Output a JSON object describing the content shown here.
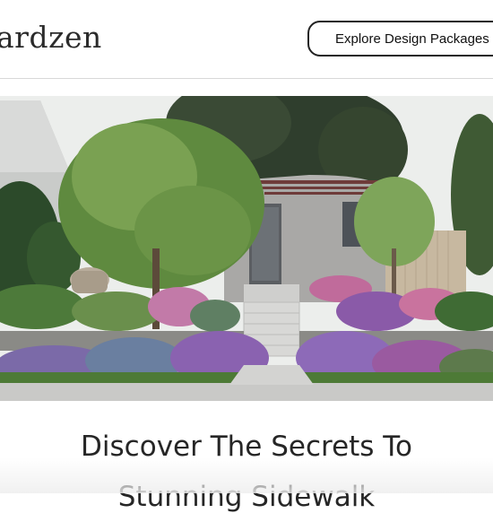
{
  "header": {
    "logo_text": "ardzen",
    "cta_label": "Explore Design Packages"
  },
  "hero": {
    "image_alt": "Front yard garden design with a modern grey house, trees, and flowering plants"
  },
  "content": {
    "heading_line1": "Discover The Secrets To",
    "heading_line2": "Stunning Sidewalk"
  },
  "colors": {
    "text": "#2b2b2b",
    "border": "#222222"
  }
}
